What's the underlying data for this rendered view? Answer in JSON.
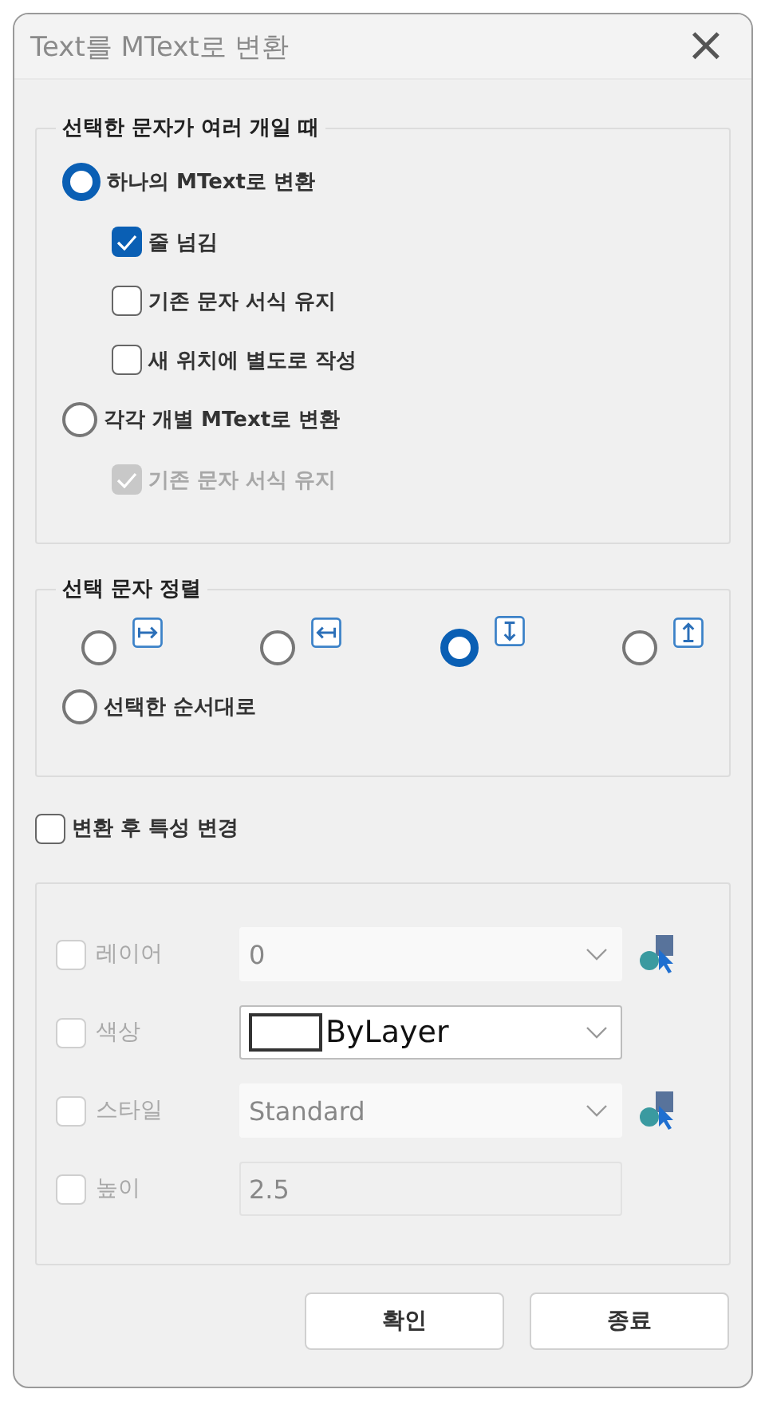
{
  "window": {
    "title": "Text를 MText로 변환",
    "close": "×"
  },
  "multiple_group": {
    "title": "선택한 문자가 여러 개일 때",
    "options": [
      {
        "kind": "radio",
        "label": "하나의 MText로 변환",
        "selected": true,
        "children": [
          {
            "label": "줄 넘김",
            "checked": true,
            "disabled": false
          },
          {
            "label": "기존 문자 서식 유지",
            "checked": false,
            "disabled": false
          },
          {
            "label": "새 위치에 별도로 작성",
            "checked": false,
            "disabled": false
          }
        ]
      },
      {
        "kind": "radio",
        "label": "각각 개별 MText로 변환",
        "selected": false,
        "children": [
          {
            "label": "기존 문자 서식 유지",
            "checked": true,
            "disabled": true
          }
        ]
      }
    ]
  },
  "align_group": {
    "title": "선택 문자 정렬",
    "options": [
      {
        "kind": "right",
        "selected": false
      },
      {
        "kind": "left",
        "selected": false
      },
      {
        "kind": "down",
        "selected": true
      },
      {
        "kind": "up",
        "selected": false
      },
      {
        "kind": "text",
        "label": "선택한 순서대로",
        "selected": false
      }
    ]
  },
  "change_props": {
    "label": "변환 후 특성 변경",
    "checked": false
  },
  "properties": [
    {
      "label": "레이어",
      "checked": false,
      "kind": "combo",
      "value": "0",
      "disabled": true,
      "picker": true
    },
    {
      "label": "색상",
      "checked": false,
      "kind": "color",
      "value": "ByLayer",
      "disabled": false,
      "picker": false
    },
    {
      "label": "스타일",
      "checked": false,
      "kind": "combo",
      "value": "Standard",
      "disabled": true,
      "picker": true
    },
    {
      "label": "높이",
      "checked": false,
      "kind": "input",
      "value": "2.5",
      "disabled": true,
      "picker": false
    }
  ],
  "buttons": [
    "확인",
    "종료"
  ]
}
